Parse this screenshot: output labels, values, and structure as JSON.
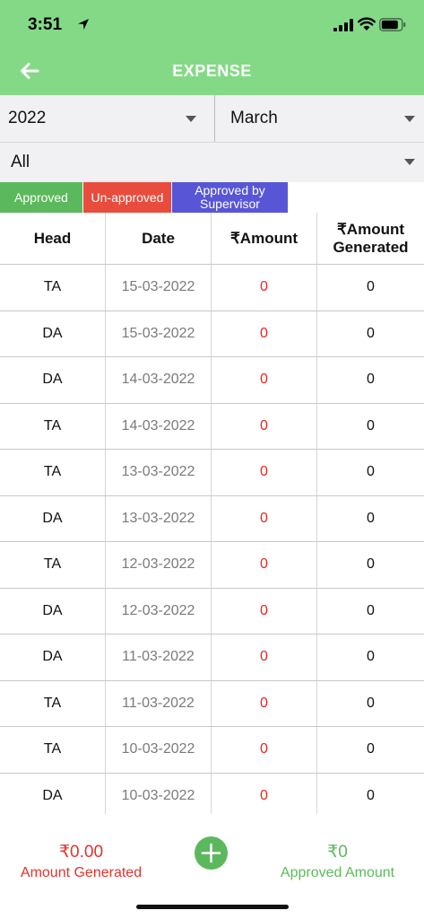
{
  "status_bar": {
    "time": "3:51"
  },
  "nav": {
    "title": "EXPENSE"
  },
  "filters": {
    "year": "2022",
    "month": "March",
    "status": "All"
  },
  "legend": {
    "approved": "Approved",
    "unapproved": "Un-approved",
    "supervisor": "Approved by Supervisor"
  },
  "table": {
    "headers": [
      "Head",
      "Date",
      "₹Amount",
      "₹Amount Generated"
    ],
    "rows": [
      {
        "head": "TA",
        "date": "15-03-2022",
        "amount": "0",
        "generated": "0"
      },
      {
        "head": "DA",
        "date": "15-03-2022",
        "amount": "0",
        "generated": "0"
      },
      {
        "head": "DA",
        "date": "14-03-2022",
        "amount": "0",
        "generated": "0"
      },
      {
        "head": "TA",
        "date": "14-03-2022",
        "amount": "0",
        "generated": "0"
      },
      {
        "head": "TA",
        "date": "13-03-2022",
        "amount": "0",
        "generated": "0"
      },
      {
        "head": "DA",
        "date": "13-03-2022",
        "amount": "0",
        "generated": "0"
      },
      {
        "head": "TA",
        "date": "12-03-2022",
        "amount": "0",
        "generated": "0"
      },
      {
        "head": "DA",
        "date": "12-03-2022",
        "amount": "0",
        "generated": "0"
      },
      {
        "head": "DA",
        "date": "11-03-2022",
        "amount": "0",
        "generated": "0"
      },
      {
        "head": "TA",
        "date": "11-03-2022",
        "amount": "0",
        "generated": "0"
      },
      {
        "head": "TA",
        "date": "10-03-2022",
        "amount": "0",
        "generated": "0"
      },
      {
        "head": "DA",
        "date": "10-03-2022",
        "amount": "0",
        "generated": "0"
      }
    ]
  },
  "footer": {
    "amount_generated_value": "₹0.00",
    "amount_generated_label": "Amount Generated",
    "approved_amount_value": "₹0",
    "approved_amount_label": "Approved Amount"
  },
  "colors": {
    "header_bg": "#84d987",
    "approved": "#5cb85c",
    "unapproved": "#e84c3d",
    "supervisor": "#5856d6",
    "amount_red": "#e5261e"
  }
}
